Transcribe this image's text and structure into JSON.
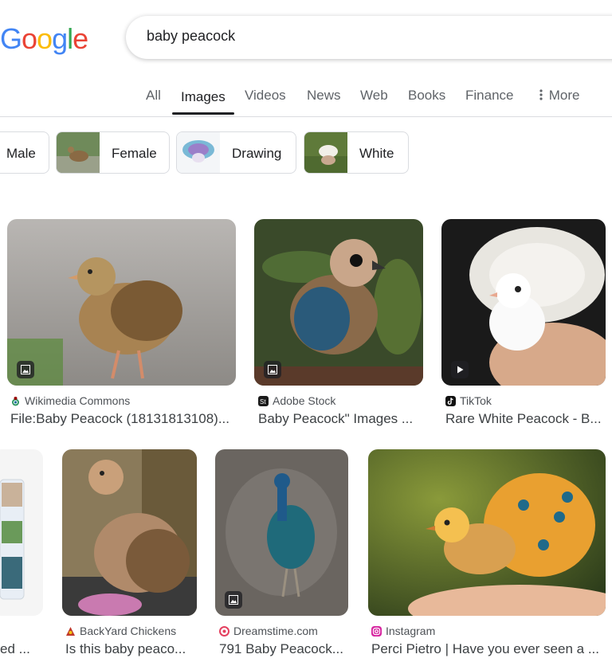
{
  "search": {
    "query": "baby peacock"
  },
  "logo": {
    "text": "Google"
  },
  "tabs": [
    {
      "label": "All"
    },
    {
      "label": "Images"
    },
    {
      "label": "Videos"
    },
    {
      "label": "News"
    },
    {
      "label": "Web"
    },
    {
      "label": "Books"
    },
    {
      "label": "Finance"
    },
    {
      "label": "More"
    }
  ],
  "chips": [
    {
      "label": "Male"
    },
    {
      "label": "Female"
    },
    {
      "label": "Drawing"
    },
    {
      "label": "White"
    }
  ],
  "results": [
    {
      "source": "Wikimedia Commons",
      "caption": "File:Baby Peacock (18131813108)...",
      "badge": "image-icon"
    },
    {
      "source": "Adobe Stock",
      "caption": "Baby Peacock\" Images ...",
      "badge": "image-icon"
    },
    {
      "source": "TikTok",
      "caption": "Rare White Peacock - B...",
      "badge": "play-icon"
    },
    {
      "source": "",
      "caption": "ed ...",
      "badge": ""
    },
    {
      "source": "BackYard Chickens",
      "caption": "Is this baby peaco...",
      "badge": ""
    },
    {
      "source": "Dreamstime.com",
      "caption": "791 Baby Peacock...",
      "badge": "image-icon"
    },
    {
      "source": "Instagram",
      "caption": "Perci Pietro | Have you ever seen a ...",
      "badge": ""
    }
  ],
  "colors": {
    "google_blue": "#4285F4",
    "google_red": "#EA4335",
    "google_yellow": "#FBBC05",
    "google_green": "#34A853"
  }
}
